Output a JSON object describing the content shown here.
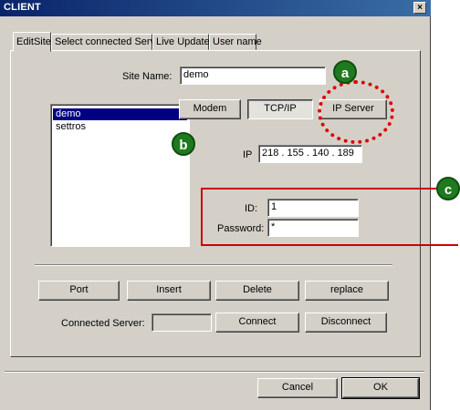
{
  "window": {
    "title": "CLIENT",
    "close_glyph": "×"
  },
  "tabs": [
    {
      "label": "EditSite",
      "active": true
    },
    {
      "label": "Select connected Server",
      "active": false
    },
    {
      "label": "Live Update",
      "active": false
    },
    {
      "label": "User name",
      "active": false
    }
  ],
  "site": {
    "name_label": "Site Name:",
    "name_value": "demo"
  },
  "sites_list": [
    {
      "label": "demo",
      "selected": true
    },
    {
      "label": "settros",
      "selected": false
    }
  ],
  "connection": {
    "modem_label": "Modem",
    "tcpip_label": "TCP/IP",
    "ipserver_label": "IP Server",
    "selected": "TCP/IP",
    "ip_label": "IP",
    "ip_value": "218 . 155 . 140 . 189"
  },
  "auth": {
    "id_label": "ID:",
    "id_value": "1",
    "password_label": "Password:",
    "password_value": "*"
  },
  "actions": {
    "port": "Port",
    "insert": "Insert",
    "delete": "Delete",
    "replace": "replace"
  },
  "server": {
    "label": "Connected Server:",
    "value": "",
    "connect": "Connect",
    "disconnect": "Disconnect"
  },
  "footer": {
    "cancel": "Cancel",
    "ok": "OK"
  },
  "annotations": {
    "a": "a",
    "b": "b",
    "c": "c",
    "color_badge": "#1f7a1f",
    "color_highlight": "#e00000"
  }
}
